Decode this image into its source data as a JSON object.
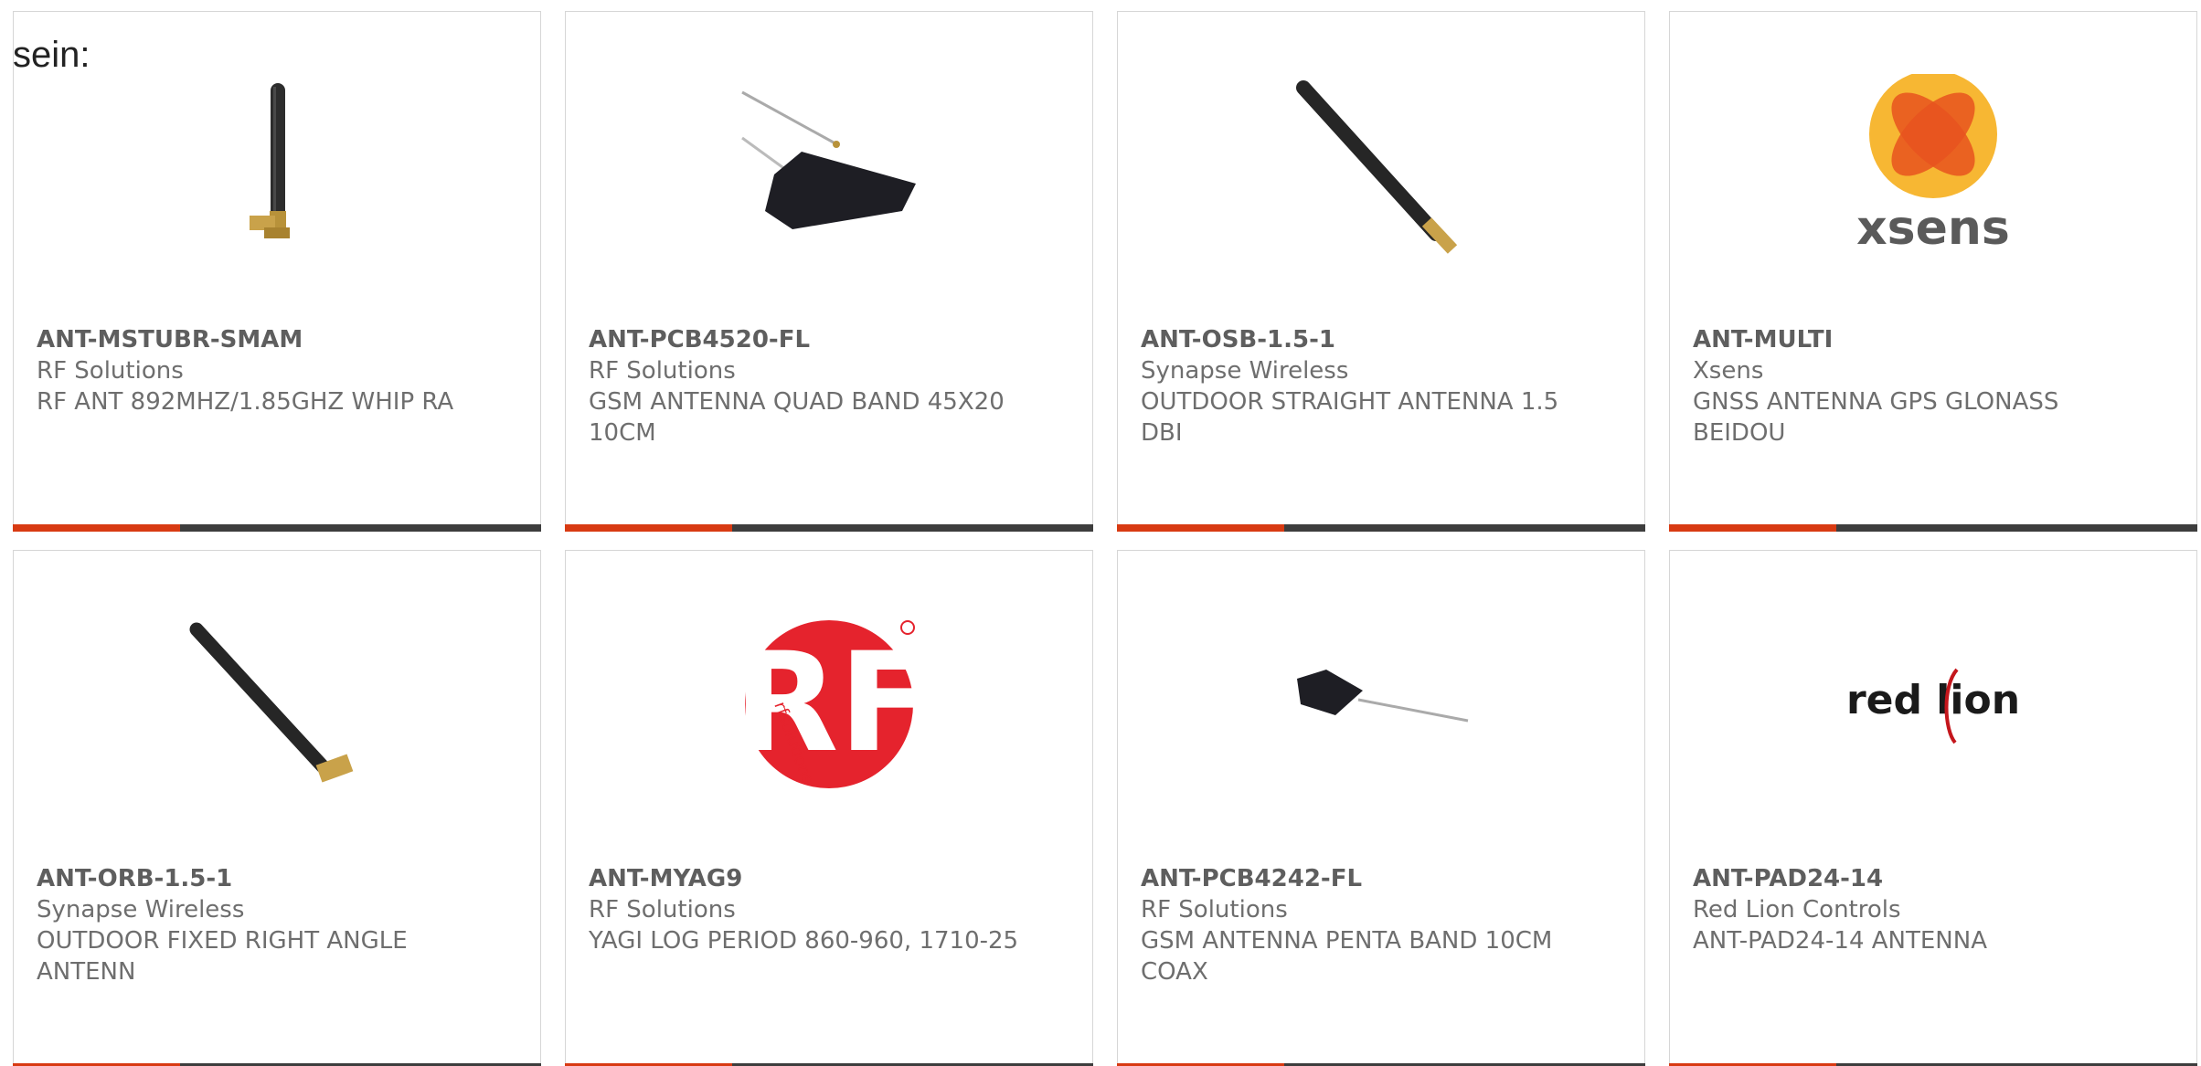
{
  "intro_text": "sein:",
  "accent_color": "#d83a12",
  "bar_color": "#3d3d3d",
  "products": [
    {
      "part": "ANT-MSTUBR-SMAM",
      "manufacturer": "RF Solutions",
      "description": "RF ANT 892MHZ/1.85GHZ WHIP RA",
      "image": "stub-antenna-right-angle"
    },
    {
      "part": "ANT-PCB4520-FL",
      "manufacturer": "RF Solutions",
      "description": "GSM ANTENNA QUAD BAND 45X20 10CM",
      "image": "pcb-patch-antenna"
    },
    {
      "part": "ANT-OSB-1.5-1",
      "manufacturer": "Synapse Wireless",
      "description": "OUTDOOR STRAIGHT ANTENNA 1.5 DBI",
      "image": "straight-whip-antenna"
    },
    {
      "part": "ANT-MULTI",
      "manufacturer": "Xsens",
      "description": "GNSS ANTENNA GPS GLONASS BEIDOU",
      "image": "xsens-logo",
      "logo_text": "xsens"
    },
    {
      "part": "ANT-ORB-1.5-1",
      "manufacturer": "Synapse Wireless",
      "description": "OUTDOOR FIXED RIGHT ANGLE ANTENN",
      "image": "right-angle-whip-antenna"
    },
    {
      "part": "ANT-MYAG9",
      "manufacturer": "RF Solutions",
      "description": "YAGI LOG PERIOD 860-960, 1710-25",
      "image": "rf-solutions-logo",
      "logo_text": "rfsolutions"
    },
    {
      "part": "ANT-PCB4242-FL",
      "manufacturer": "RF Solutions",
      "description": "GSM ANTENNA PENTA BAND 10CM COAX",
      "image": "pcb-square-antenna"
    },
    {
      "part": "ANT-PAD24-14",
      "manufacturer": "Red Lion Controls",
      "description": "ANT-PAD24-14 ANTENNA",
      "image": "red-lion-logo",
      "logo_text": "red lion"
    }
  ]
}
